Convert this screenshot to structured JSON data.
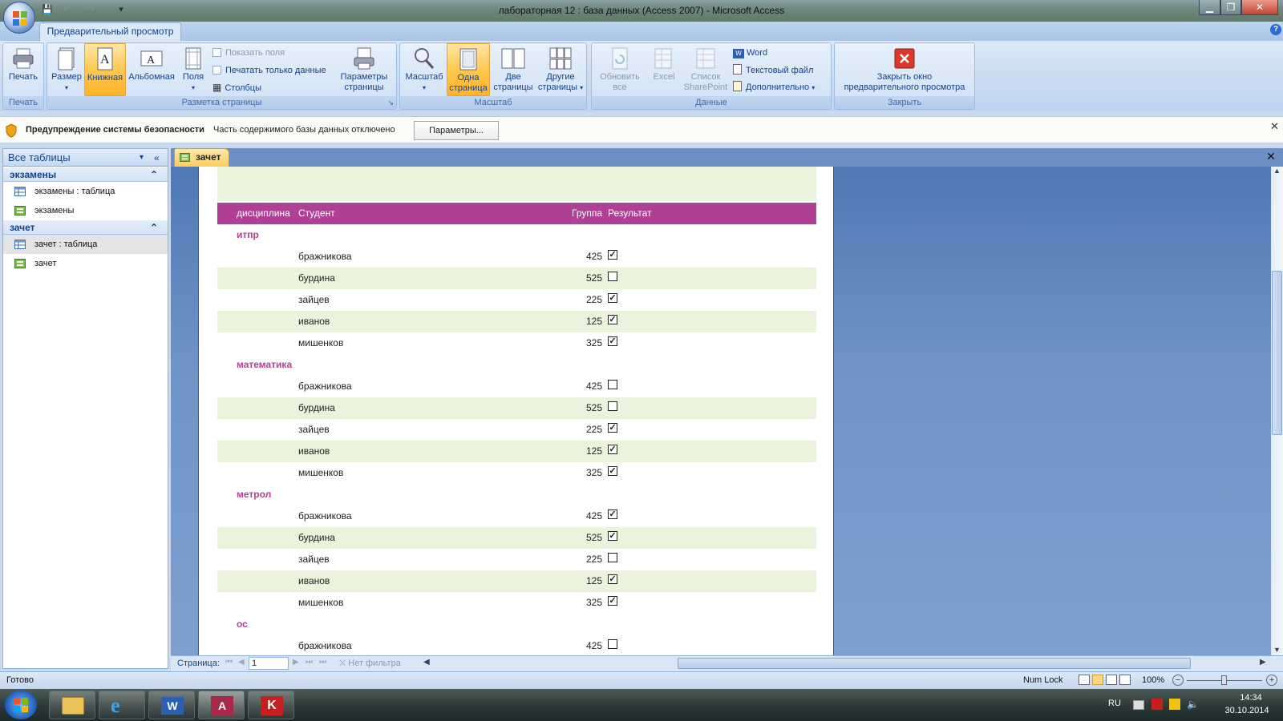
{
  "window": {
    "title": "лабораторная 12 : база данных (Access 2007) - Microsoft Access",
    "min_label": "▁",
    "max_label": "❐",
    "close_label": "✕"
  },
  "qat": {
    "save": "💾",
    "undo": "↶",
    "redo": "↷",
    "more": "▾"
  },
  "ribbon": {
    "tab": "Предварительный просмотр",
    "help": "?",
    "groups": {
      "print": {
        "label": "Печать",
        "print_btn": "Печать"
      },
      "layout": {
        "label": "Разметка страницы",
        "size": "Размер",
        "portrait": "Книжная",
        "landscape": "Альбомная",
        "margins": "Поля",
        "show_margins": "Показать поля",
        "print_data_only": "Печатать только данные",
        "columns": "Столбцы",
        "page_setup_1": "Параметры",
        "page_setup_2": "страницы"
      },
      "zoom": {
        "label": "Масштаб",
        "zoom": "Масштаб",
        "one_page_1": "Одна",
        "one_page_2": "страница",
        "two_pages_1": "Две",
        "two_pages_2": "страницы",
        "more_pages_1": "Другие",
        "more_pages_2": "страницы"
      },
      "data": {
        "label": "Данные",
        "refresh_1": "Обновить",
        "refresh_2": "все",
        "excel": "Excel",
        "sharepoint_1": "Список",
        "sharepoint_2": "SharePoint",
        "word": "Word",
        "text_file": "Текстовый файл",
        "more": "Дополнительно"
      },
      "close": {
        "label": "Закрыть",
        "close_1": "Закрыть окно",
        "close_2": "предварительного просмотра"
      }
    }
  },
  "security": {
    "title": "Предупреждение системы безопасности",
    "message": "Часть содержимого базы данных отключено",
    "button": "Параметры..."
  },
  "nav": {
    "header": "Все таблицы",
    "groups": [
      {
        "name": "экзамены",
        "items": [
          {
            "label": "экзамены : таблица",
            "type": "table"
          },
          {
            "label": "экзамены",
            "type": "report"
          }
        ]
      },
      {
        "name": "зачет",
        "items": [
          {
            "label": "зачет : таблица",
            "type": "table"
          },
          {
            "label": "зачет",
            "type": "report"
          }
        ]
      }
    ]
  },
  "doc_tab": {
    "label": "зачет"
  },
  "report": {
    "columns": {
      "discipline": "дисциплина",
      "student": "Студент",
      "group": "Группа",
      "result": "Результат"
    },
    "sections": [
      {
        "name": "итпр",
        "rows": [
          {
            "student": "бражникова",
            "group": "425",
            "result": true
          },
          {
            "student": "бурдина",
            "group": "525",
            "result": false
          },
          {
            "student": "зайцев",
            "group": "225",
            "result": true
          },
          {
            "student": "иванов",
            "group": "125",
            "result": true
          },
          {
            "student": "мишенков",
            "group": "325",
            "result": true
          }
        ]
      },
      {
        "name": "математика",
        "rows": [
          {
            "student": "бражникова",
            "group": "425",
            "result": false
          },
          {
            "student": "бурдина",
            "group": "525",
            "result": false
          },
          {
            "student": "зайцев",
            "group": "225",
            "result": true
          },
          {
            "student": "иванов",
            "group": "125",
            "result": true
          },
          {
            "student": "мишенков",
            "group": "325",
            "result": true
          }
        ]
      },
      {
        "name": "метрол",
        "rows": [
          {
            "student": "бражникова",
            "group": "425",
            "result": true
          },
          {
            "student": "бурдина",
            "group": "525",
            "result": true
          },
          {
            "student": "зайцев",
            "group": "225",
            "result": false
          },
          {
            "student": "иванов",
            "group": "125",
            "result": true
          },
          {
            "student": "мишенков",
            "group": "325",
            "result": true
          }
        ]
      },
      {
        "name": "ос",
        "rows": [
          {
            "student": "бражникова",
            "group": "425",
            "result": false
          }
        ]
      }
    ]
  },
  "pager": {
    "label": "Страница:",
    "page": "1",
    "filter": "Нет фильтра"
  },
  "status": {
    "ready": "Готово",
    "numlock": "Num Lock",
    "zoom": "100%"
  },
  "tray": {
    "lang": "RU",
    "time": "14:34",
    "date": "30.10.2014"
  },
  "colors": {
    "accent": "#b03f96",
    "band": "#ebf3dd"
  }
}
